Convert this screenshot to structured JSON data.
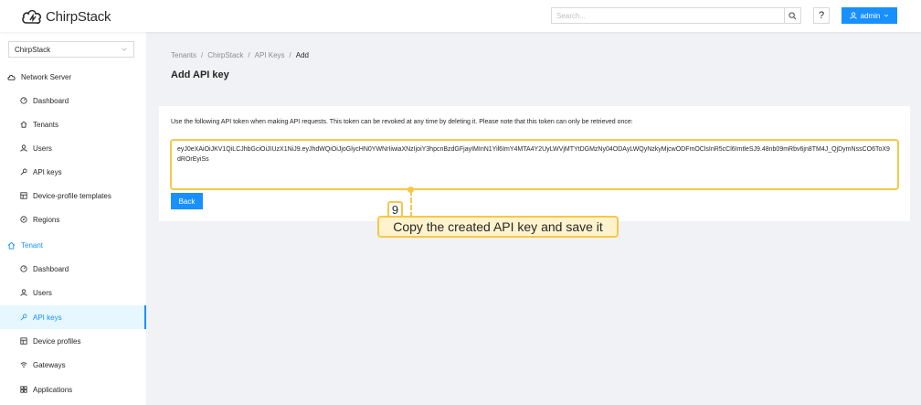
{
  "header": {
    "logo_text": "ChirpStack",
    "search_placeholder": "Search...",
    "help_label": "?",
    "user_label": "admin"
  },
  "sidebar": {
    "tenant_select_value": "ChirpStack",
    "network_server": {
      "label": "Network Server",
      "items": [
        {
          "label": "Dashboard"
        },
        {
          "label": "Tenants"
        },
        {
          "label": "Users"
        },
        {
          "label": "API keys"
        },
        {
          "label": "Device-profile templates"
        },
        {
          "label": "Regions"
        }
      ]
    },
    "tenant": {
      "label": "Tenant",
      "items": [
        {
          "label": "Dashboard"
        },
        {
          "label": "Users"
        },
        {
          "label": "API keys"
        },
        {
          "label": "Device profiles"
        },
        {
          "label": "Gateways"
        },
        {
          "label": "Applications"
        }
      ]
    }
  },
  "breadcrumb": {
    "items": [
      "Tenants",
      "ChirpStack",
      "API Keys",
      "Add"
    ],
    "separator": "/"
  },
  "page_title": "Add API key",
  "card": {
    "info": "Use the following API token when making API requests. This token can be revoked at any time by deleting it. Please note that this token can only be retrieved once:",
    "token": "eyJ0eXAiOiJKV1QiLCJhbGciOiJIUzX1NiJ9.eyJhdWQiOiJjoGlycHN0YWNrIiwiaXNzIjoiY3hpcnBzdGFjayIMInN1Yil6ImY4MTA4Y2UyLWVjMTYtDGMzNy04ODAyLWQyNzkyMjcwODFmOClsInR5cCl6ImtleSJ9.48nb09mRbv6jn8TM4J_QjDymNssCO6ToX9dROrEyiSs",
    "back_label": "Back"
  },
  "annotation": {
    "step": "9",
    "text": "Copy the created API key and save it"
  },
  "colors": {
    "primary": "#1890ff",
    "highlight": "#f7c74a",
    "callout_bg": "#fff3cd"
  }
}
